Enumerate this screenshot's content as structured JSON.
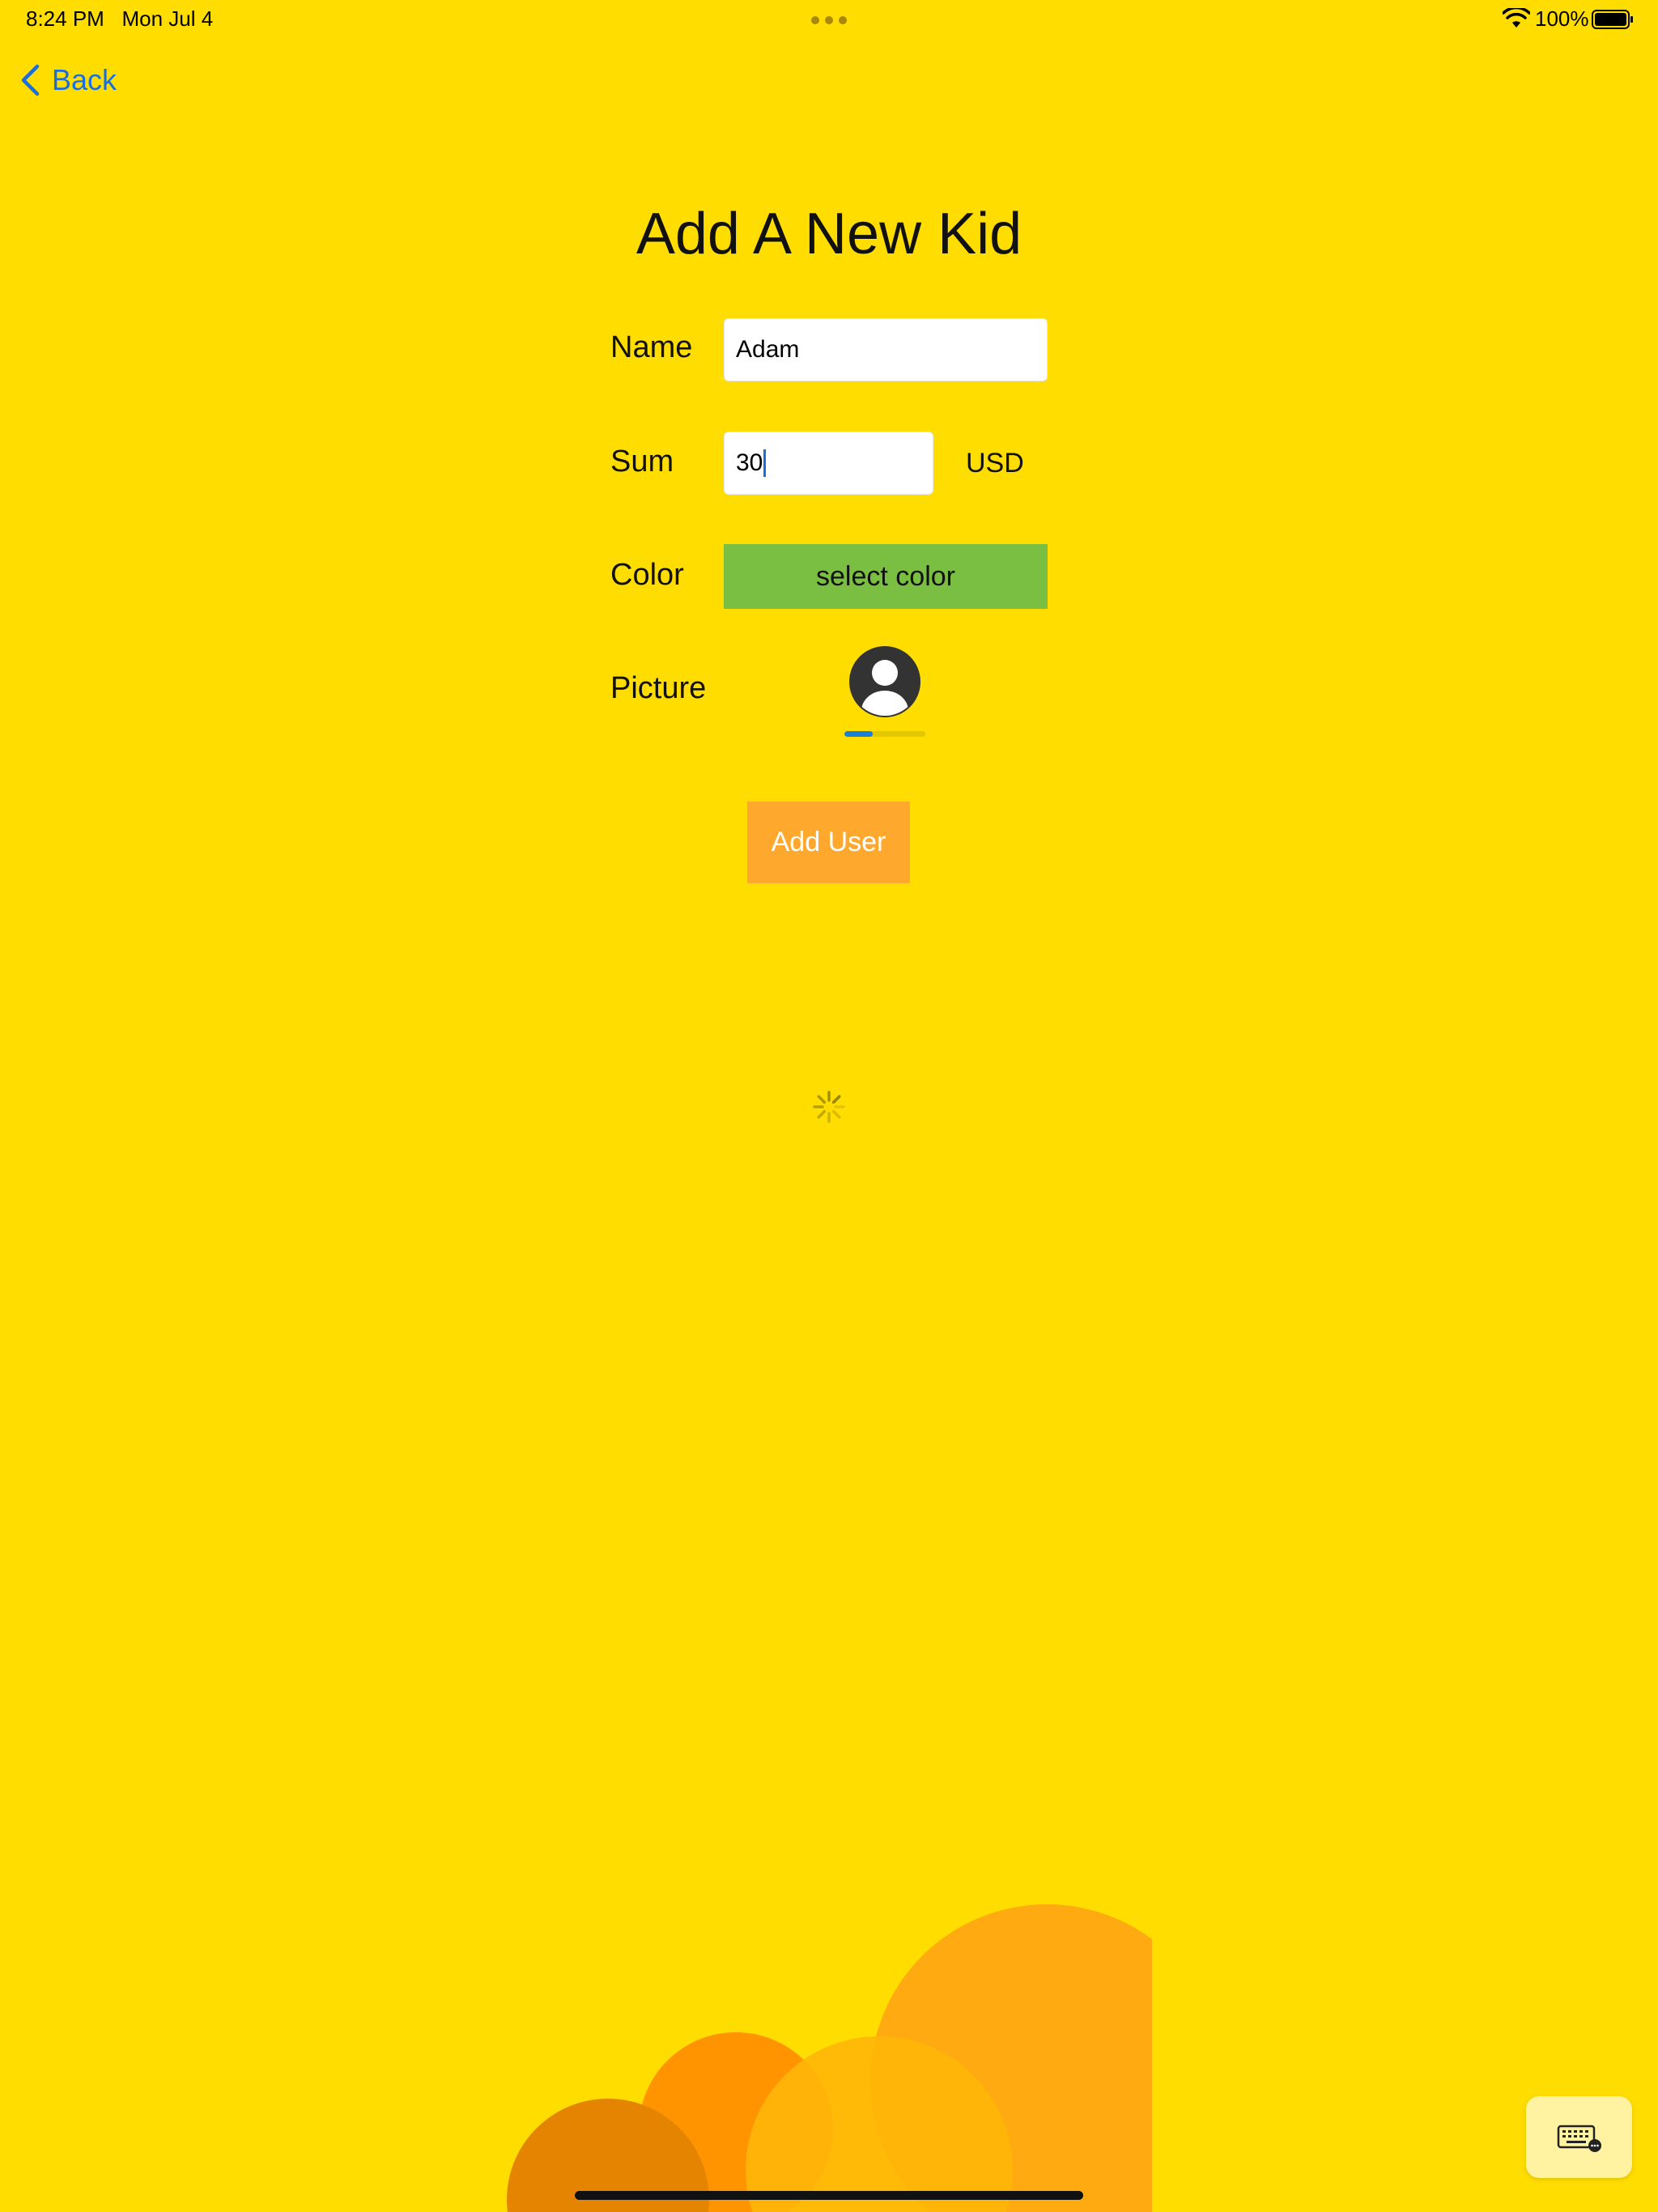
{
  "status_bar": {
    "time": "8:24 PM",
    "date": "Mon Jul 4",
    "battery": "100%"
  },
  "nav": {
    "back_label": "Back"
  },
  "form": {
    "title": "Add A New Kid",
    "name_label": "Name",
    "name_value": "Adam",
    "sum_label": "Sum",
    "sum_value": "30",
    "currency": "USD",
    "color_label": "Color",
    "select_color_label": "select color",
    "picture_label": "Picture",
    "upload_progress": 0.35,
    "submit_label": "Add User"
  },
  "colors": {
    "background": "#FFDD00",
    "accent_link": "#1A6FE0",
    "select_color_button": "#7BBF42",
    "submit_button": "#FFA82E"
  },
  "icons": {
    "back": "chevron-left-icon",
    "avatar": "user-avatar-icon",
    "spinner": "loading-spinner-icon",
    "keyboard": "keyboard-icon",
    "wifi": "wifi-icon",
    "battery": "battery-icon"
  }
}
